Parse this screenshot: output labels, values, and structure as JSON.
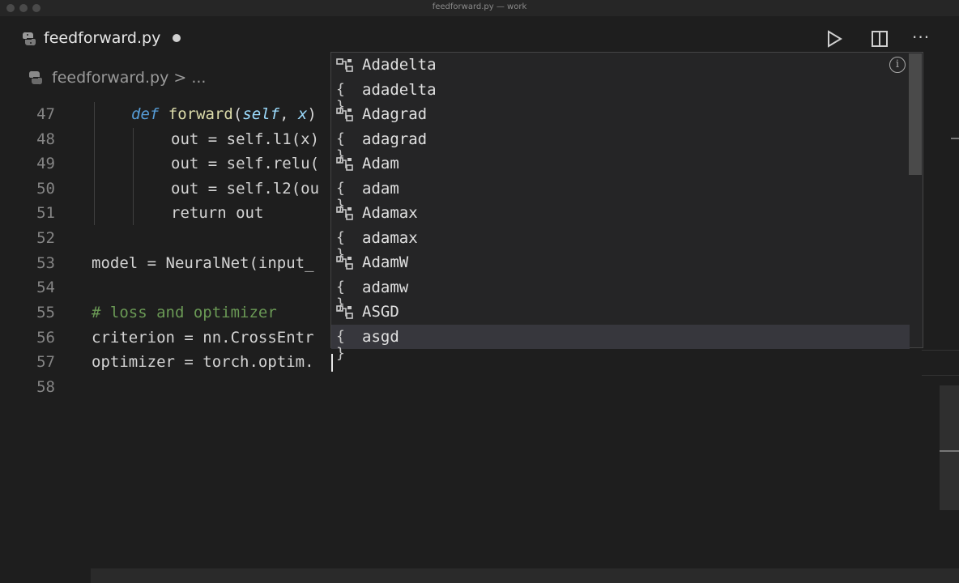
{
  "window": {
    "title": "feedforward.py — work"
  },
  "tab": {
    "filename": "feedforward.py",
    "modified": true
  },
  "breadcrumb": {
    "file": "feedforward.py",
    "separator": ">",
    "ellipsis": "..."
  },
  "toolbar": {
    "run_icon": "play-icon",
    "split_icon": "split-editor-icon",
    "more_icon": "more-actions-icon",
    "more_label": "···"
  },
  "code_lines": [
    {
      "num": "47",
      "text": "    def forward(self, x)"
    },
    {
      "num": "48",
      "text": "        out = self.l1(x)"
    },
    {
      "num": "49",
      "text": "        out = self.relu("
    },
    {
      "num": "50",
      "text": "        out = self.l2(ou"
    },
    {
      "num": "51",
      "text": "        return out"
    },
    {
      "num": "52",
      "text": ""
    },
    {
      "num": "53",
      "text": "model = NeuralNet(input_"
    },
    {
      "num": "54",
      "text": ""
    },
    {
      "num": "55",
      "text": "# loss and optimizer"
    },
    {
      "num": "56",
      "text": "criterion = nn.CrossEntr"
    },
    {
      "num": "57",
      "text": "optimizer = torch.optim."
    },
    {
      "num": "58",
      "text": ""
    }
  ],
  "code_tokens": {
    "l47": {
      "kw": "def",
      "fn": "forward",
      "open": "(",
      "self": "self",
      "comma": ", ",
      "x": "x",
      "close": ")"
    },
    "l48": "out = self.l1(x)",
    "l49": "out = self.relu(",
    "l50": "out = self.l2(ou",
    "l51": "return out",
    "l53": "model = NeuralNet(input_",
    "l55": "# loss and optimizer",
    "l56": "criterion = nn.CrossEntr",
    "l57": "optimizer = torch.optim."
  },
  "suggestions": [
    {
      "label": "Adadelta",
      "kind": "class"
    },
    {
      "label": "adadelta",
      "kind": "module"
    },
    {
      "label": "Adagrad",
      "kind": "class"
    },
    {
      "label": "adagrad",
      "kind": "module"
    },
    {
      "label": "Adam",
      "kind": "class"
    },
    {
      "label": "adam",
      "kind": "module"
    },
    {
      "label": "Adamax",
      "kind": "class"
    },
    {
      "label": "adamax",
      "kind": "module"
    },
    {
      "label": "AdamW",
      "kind": "class"
    },
    {
      "label": "adamw",
      "kind": "module"
    },
    {
      "label": "ASGD",
      "kind": "class"
    },
    {
      "label": "asgd",
      "kind": "module",
      "selected": true
    }
  ],
  "suggest_info": {
    "icon": "info-icon",
    "glyph": "i"
  },
  "module_glyph": "{}",
  "colors": {
    "background": "#1e1e1e",
    "suggest_bg": "#252526",
    "selected_row": "#37373d",
    "keyword": "#569cd6"
  }
}
